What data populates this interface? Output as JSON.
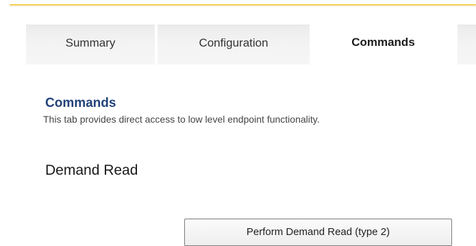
{
  "tabs": [
    {
      "label": "Summary",
      "active": false
    },
    {
      "label": "Configuration",
      "active": false
    },
    {
      "label": "Commands",
      "active": true
    }
  ],
  "section": {
    "title": "Commands",
    "description": "This tab provides direct access to low level endpoint functionality."
  },
  "demand_read": {
    "heading": "Demand Read",
    "button_label": "Perform Demand Read (type 2)"
  },
  "colors": {
    "accent": "#f1cf5a",
    "title": "#23427a",
    "inactive_tab": "#f1f1f1"
  }
}
